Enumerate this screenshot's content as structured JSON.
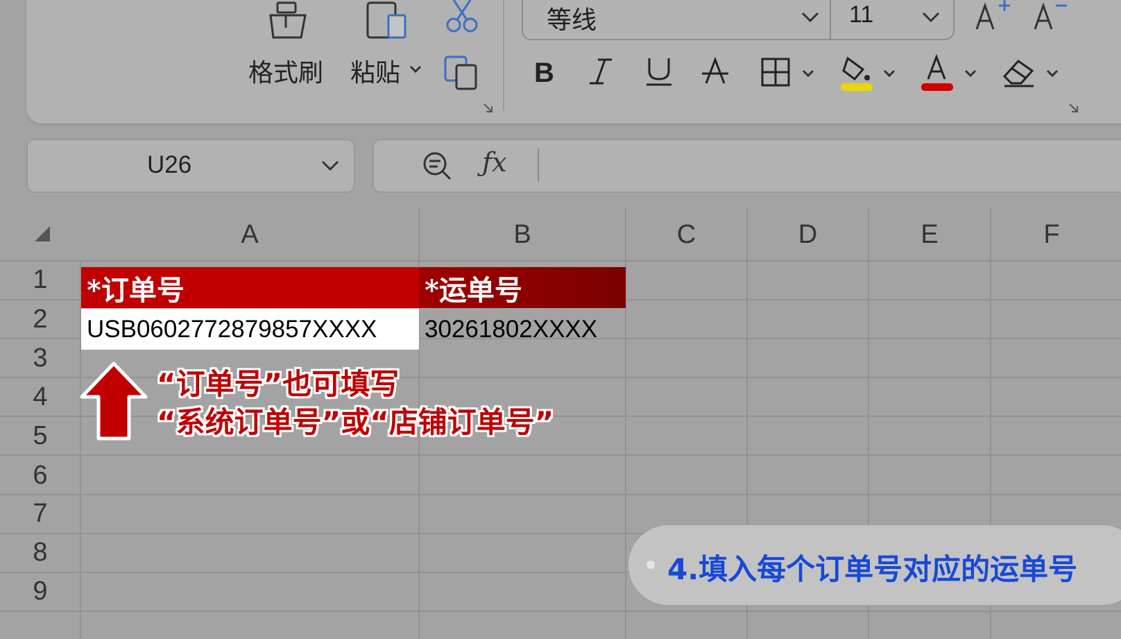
{
  "ribbon": {
    "format_painter_label": "格式刷",
    "paste_label": "粘贴",
    "font_name": "等线",
    "font_size": "11",
    "highlight_color": "#e6d60a",
    "font_color": "#d00000"
  },
  "name_box": {
    "value": "U26"
  },
  "formula_bar": {
    "value": ""
  },
  "columns": [
    "A",
    "B",
    "C",
    "D",
    "E",
    "F"
  ],
  "rows": [
    "1",
    "2",
    "3",
    "4",
    "5",
    "6",
    "7",
    "8",
    "9"
  ],
  "cells": {
    "A1": "*订单号",
    "B1": "*运单号",
    "A2": "USB0602772879857XXXX",
    "B2": "30261802XXXX"
  },
  "colors": {
    "header_a": "#c00000",
    "header_b": "#820000",
    "annotation": "#c00000",
    "step_text": "#1849d6"
  },
  "annotation": {
    "line1": "“订单号”也可填写",
    "line2": "“系统订单号”或“店铺订单号”"
  },
  "step": {
    "text": "4.填入每个订单号对应的运单号"
  }
}
